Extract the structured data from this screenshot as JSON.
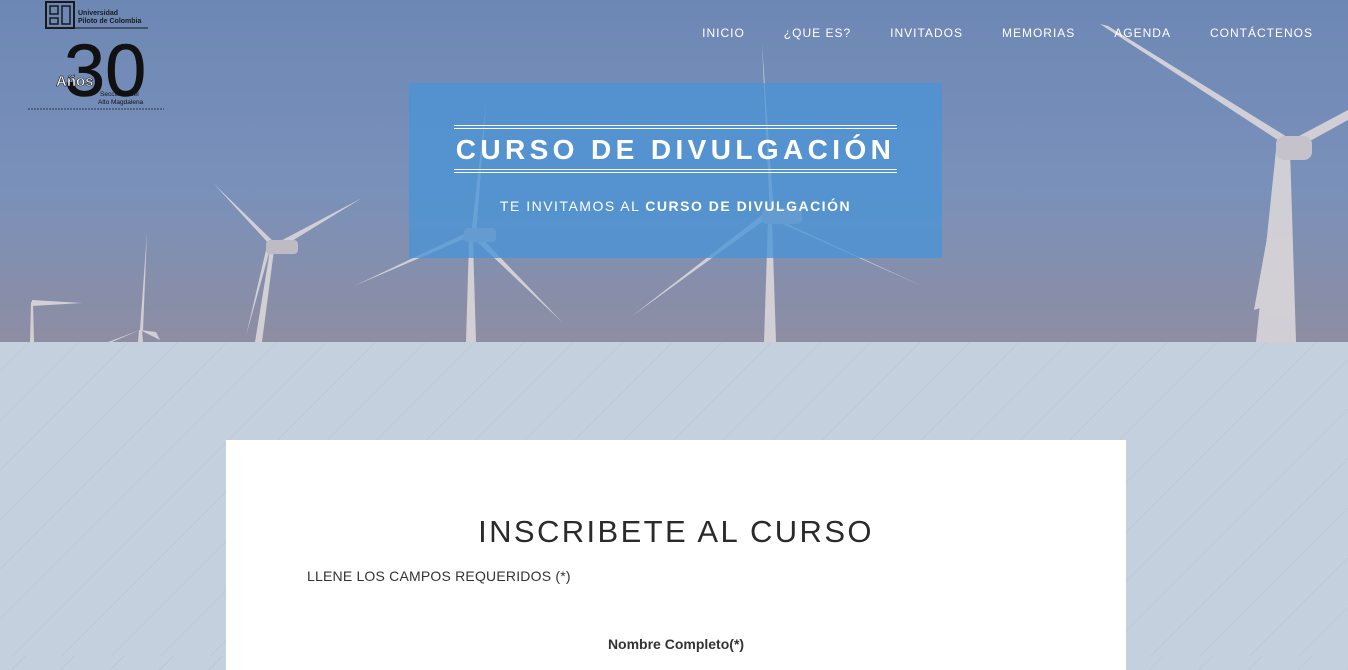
{
  "nav": {
    "items": [
      "INICIO",
      "¿QUE ES?",
      "INVITADOS",
      "MEMORIAS",
      "AGENDA",
      "CONTÁCTENOS"
    ]
  },
  "logo": {
    "university": "Universidad Piloto de Colombia",
    "years_number": "30",
    "years_word": "Años",
    "seccional": "Seccional del Alto Magdalena"
  },
  "hero": {
    "title": "CURSO DE DIVULGACIÓN",
    "subtitle_prefix": "TE INVITAMOS AL",
    "subtitle_bold": "CURSO DE DIVULGACIÓN"
  },
  "form": {
    "heading": "INSCRIBETE AL CURSO",
    "required_note": "LLENE LOS CAMPOS REQUERIDOS (*)",
    "field_full_name_label": "Nombre Completo(*)"
  },
  "colors": {
    "banner": "#4a94d6",
    "page_background": "#c5d0de",
    "card": "#ffffff"
  }
}
